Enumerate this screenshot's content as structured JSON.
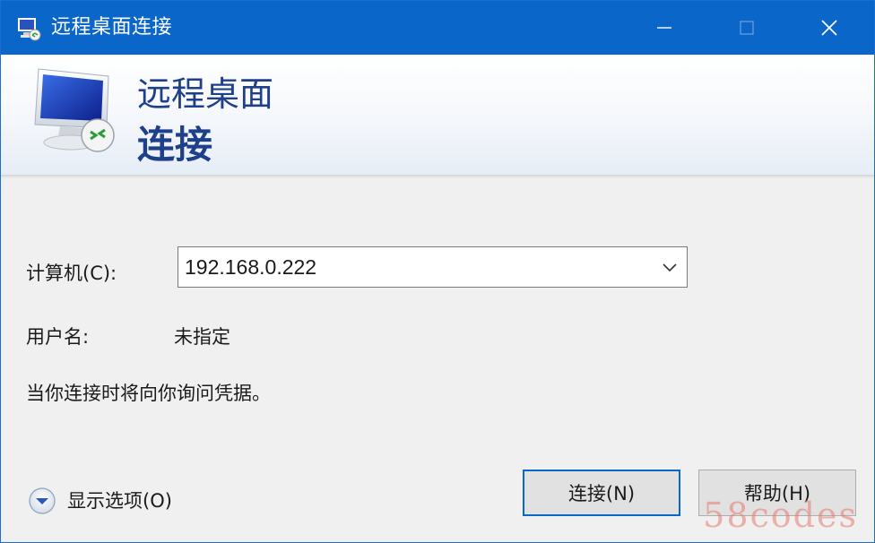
{
  "window": {
    "title": "远程桌面连接",
    "controls": {
      "minimize_icon": "minimize-icon",
      "maximize_icon": "maximize-icon",
      "close_icon": "close-icon"
    }
  },
  "banner": {
    "line1": "远程桌面",
    "line2": "连接",
    "icon": "remote-desktop-monitor-icon"
  },
  "form": {
    "computer_label": "计算机(C):",
    "computer_value": "192.168.0.222",
    "user_label": "用户名:",
    "user_value": "未指定",
    "info": "当你连接时将向你询问凭据。"
  },
  "options": {
    "label": "显示选项(O)",
    "icon": "chevron-down-circle-icon"
  },
  "buttons": {
    "connect": "连接(N)",
    "help": "帮助(H)"
  },
  "watermark": "58codes",
  "colors": {
    "titlebar": "#0a66c8",
    "banner_text": "#1e3f8a",
    "default_button_border": "#0a66c8"
  }
}
